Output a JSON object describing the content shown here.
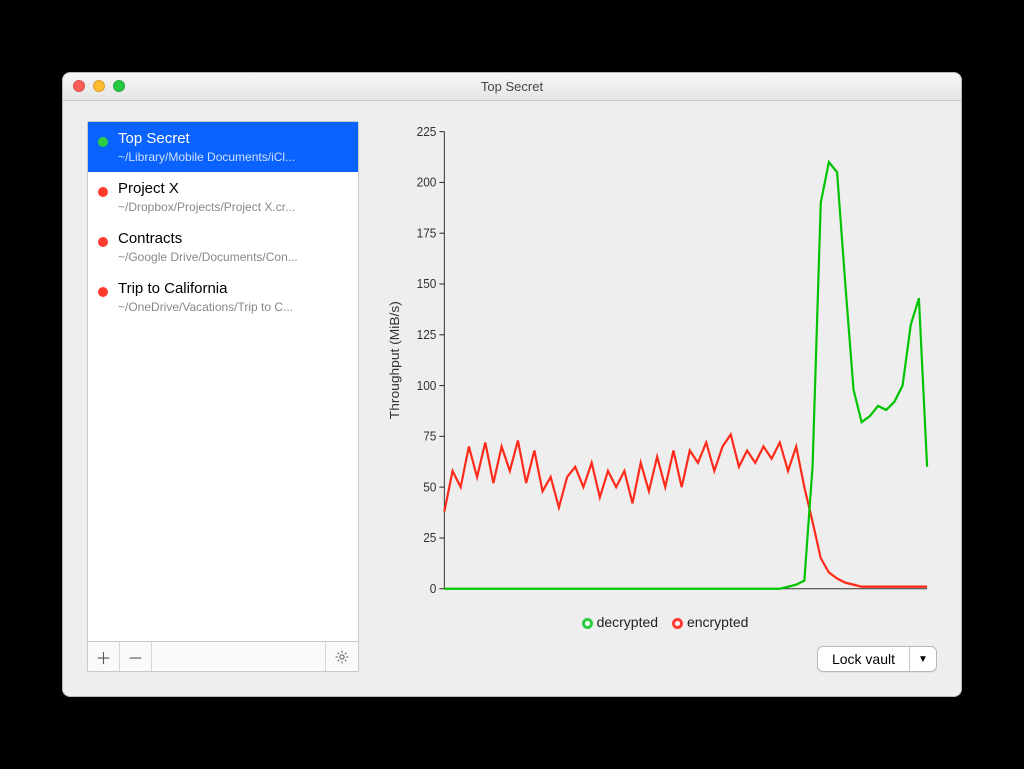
{
  "window": {
    "title": "Top Secret"
  },
  "sidebar": {
    "vaults": [
      {
        "name": "Top Secret",
        "path": "~/Library/Mobile Documents/iCl...",
        "status": "unlocked",
        "selected": true
      },
      {
        "name": "Project X",
        "path": "~/Dropbox/Projects/Project X.cr...",
        "status": "locked",
        "selected": false
      },
      {
        "name": "Contracts",
        "path": "~/Google Drive/Documents/Con...",
        "status": "locked",
        "selected": false
      },
      {
        "name": "Trip to California",
        "path": "~/OneDrive/Vacations/Trip to C...",
        "status": "locked",
        "selected": false
      }
    ]
  },
  "legend": {
    "decrypted": "decrypted",
    "encrypted": "encrypted"
  },
  "actions": {
    "lock_vault": "Lock vault"
  },
  "chart_data": {
    "type": "line",
    "ylabel": "Throughput (MiB/s)",
    "xlabel": "",
    "ylim": [
      0,
      225
    ],
    "yticks": [
      0,
      25,
      50,
      75,
      100,
      125,
      150,
      175,
      200,
      225
    ],
    "x": [
      0,
      1,
      2,
      3,
      4,
      5,
      6,
      7,
      8,
      9,
      10,
      11,
      12,
      13,
      14,
      15,
      16,
      17,
      18,
      19,
      20,
      21,
      22,
      23,
      24,
      25,
      26,
      27,
      28,
      29,
      30,
      31,
      32,
      33,
      34,
      35,
      36,
      37,
      38,
      39,
      40,
      41,
      42,
      43,
      44,
      45,
      46,
      47,
      48,
      49,
      50,
      51,
      52,
      53,
      54,
      55,
      56,
      57,
      58,
      59
    ],
    "series": [
      {
        "name": "encrypted",
        "color": "#ff2a1a",
        "values": [
          38,
          58,
          50,
          70,
          55,
          72,
          52,
          70,
          58,
          73,
          52,
          68,
          48,
          55,
          40,
          55,
          60,
          50,
          62,
          45,
          58,
          50,
          58,
          42,
          62,
          48,
          65,
          50,
          68,
          50,
          68,
          62,
          72,
          58,
          70,
          76,
          60,
          68,
          62,
          70,
          64,
          72,
          58,
          70,
          50,
          33,
          15,
          8,
          5,
          3,
          2,
          1,
          1,
          1,
          1,
          1,
          1,
          1,
          1,
          1
        ]
      },
      {
        "name": "decrypted",
        "color": "#00c400",
        "values": [
          0,
          0,
          0,
          0,
          0,
          0,
          0,
          0,
          0,
          0,
          0,
          0,
          0,
          0,
          0,
          0,
          0,
          0,
          0,
          0,
          0,
          0,
          0,
          0,
          0,
          0,
          0,
          0,
          0,
          0,
          0,
          0,
          0,
          0,
          0,
          0,
          0,
          0,
          0,
          0,
          0,
          0,
          1,
          2,
          4,
          60,
          190,
          210,
          205,
          150,
          98,
          82,
          85,
          90,
          88,
          92,
          100,
          130,
          143,
          60
        ]
      }
    ]
  }
}
